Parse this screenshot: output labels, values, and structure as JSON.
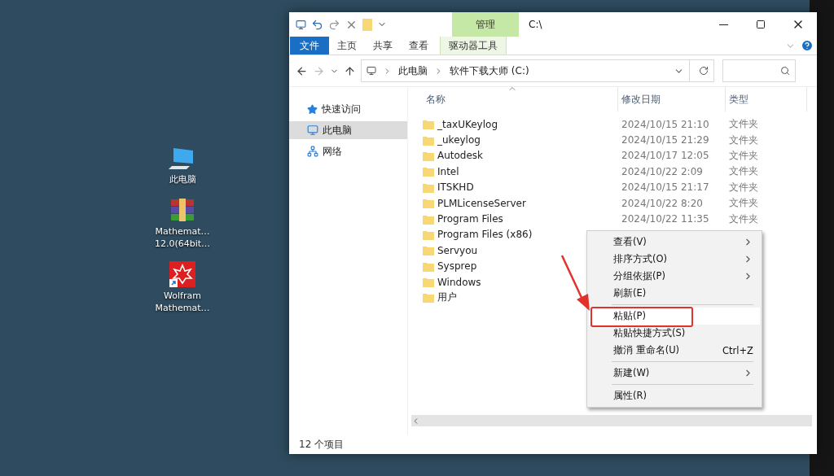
{
  "desktop_icons": [
    {
      "kind": "computer",
      "label": "此电脑"
    },
    {
      "kind": "archive",
      "label": "Mathemat…\n12.0(64bit…"
    },
    {
      "kind": "app",
      "label": "Wolfram\nMathemat…"
    }
  ],
  "window": {
    "title": "C:\\",
    "context_tab": "管理",
    "ribbon_tabs": [
      {
        "label": "文件",
        "kind": "file"
      },
      {
        "label": "主页",
        "kind": "tab"
      },
      {
        "label": "共享",
        "kind": "tab"
      },
      {
        "label": "查看",
        "kind": "tab"
      },
      {
        "label": "驱动器工具",
        "kind": "context"
      }
    ],
    "path": [
      "此电脑",
      "软件下载大师 (C:)"
    ]
  },
  "sidebar": {
    "items": [
      {
        "kind": "star",
        "label": "快速访问",
        "selected": false
      },
      {
        "kind": "computer",
        "label": "此电脑",
        "selected": true
      },
      {
        "kind": "network",
        "label": "网络",
        "selected": false
      }
    ]
  },
  "table": {
    "columns": [
      "名称",
      "修改日期",
      "类型"
    ],
    "rows": [
      {
        "name": "_taxUKeylog",
        "date": "2024/10/15 21:10",
        "type": "文件夹"
      },
      {
        "name": "_ukeylog",
        "date": "2024/10/15 21:29",
        "type": "文件夹"
      },
      {
        "name": "Autodesk",
        "date": "2024/10/17 12:05",
        "type": "文件夹"
      },
      {
        "name": "Intel",
        "date": "2024/10/22 2:09",
        "type": "文件夹"
      },
      {
        "name": "ITSKHD",
        "date": "2024/10/15 21:17",
        "type": "文件夹"
      },
      {
        "name": "PLMLicenseServer",
        "date": "2024/10/22 8:20",
        "type": "文件夹"
      },
      {
        "name": "Program Files",
        "date": "2024/10/22 11:35",
        "type": "文件夹"
      },
      {
        "name": "Program Files (x86)"
      },
      {
        "name": "Servyou"
      },
      {
        "name": "Sysprep"
      },
      {
        "name": "Windows"
      },
      {
        "name": "用户"
      }
    ]
  },
  "status_bar": "12 个项目",
  "context_menu": [
    {
      "kind": "item",
      "label": "查看(V)",
      "submenu": true,
      "highlighted": false
    },
    {
      "kind": "item",
      "label": "排序方式(O)",
      "submenu": true,
      "highlighted": false
    },
    {
      "kind": "item",
      "label": "分组依据(P)",
      "submenu": true,
      "highlighted": false
    },
    {
      "kind": "item",
      "label": "刷新(E)",
      "submenu": false,
      "highlighted": false
    },
    {
      "kind": "separator"
    },
    {
      "kind": "item",
      "label": "粘贴(P)",
      "submenu": false,
      "highlighted": true
    },
    {
      "kind": "item",
      "label": "粘贴快捷方式(S)",
      "submenu": false,
      "highlighted": false
    },
    {
      "kind": "item",
      "label": "撤消 重命名(U)",
      "shortcut": "Ctrl+Z",
      "submenu": false,
      "highlighted": false
    },
    {
      "kind": "separator"
    },
    {
      "kind": "item",
      "label": "新建(W)",
      "submenu": true,
      "highlighted": false
    },
    {
      "kind": "separator"
    },
    {
      "kind": "item",
      "label": "属性(R)",
      "submenu": false,
      "highlighted": false
    }
  ]
}
